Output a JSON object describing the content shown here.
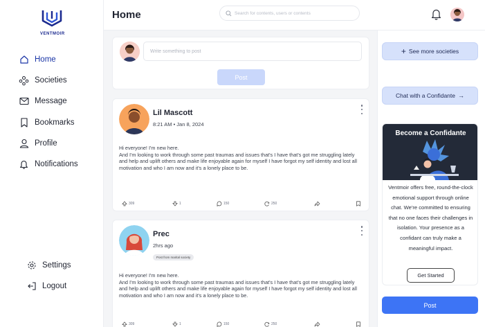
{
  "brand": {
    "logo_text": "VENTMOIR"
  },
  "sidebar": {
    "items": [
      {
        "label": "Home",
        "icon": "home-icon",
        "active": true
      },
      {
        "label": "Societies",
        "icon": "societies-icon"
      },
      {
        "label": "Message",
        "icon": "mail-icon"
      },
      {
        "label": "Bookmarks",
        "icon": "bookmark-icon"
      },
      {
        "label": "Profile",
        "icon": "user-icon"
      },
      {
        "label": "Notifications",
        "icon": "bell-icon"
      }
    ],
    "bottom": [
      {
        "label": "Settings",
        "icon": "gear-icon"
      },
      {
        "label": "Logout",
        "icon": "logout-icon"
      }
    ]
  },
  "header": {
    "title": "Home",
    "search_placeholder": "Search for contents, users or contents"
  },
  "composer": {
    "placeholder": "Write something to post",
    "post_label": "Post"
  },
  "posts": [
    {
      "author": "Lil Mascott",
      "time": "8:21 AM • Jan 8, 2024",
      "tag": "",
      "body": "Hi everyone! I'm new here.\nAnd I'm looking to work through some past traumas and issues that's I have that's got me struggling lately and help and uplift others and make life enjoyable again for myself I have forgot my self identity and lost all motivation and who I am now and it's a lonely place to be.",
      "likes": "309",
      "dislikes": "1",
      "comments": "150",
      "reposts": "250"
    },
    {
      "author": "Prec",
      "time": "2hrs ago",
      "tag": "Post from marital society",
      "body": "Hi everyone! I'm new here.\nAnd I'm looking to work through some past traumas and issues that's I have that's got me struggling lately and help and uplift others and make life enjoyable again for myself I have forgot my self identity and lost all motivation and who I am now and it's a lonely place to be.",
      "likes": "309",
      "dislikes": "1",
      "comments": "150",
      "reposts": "250"
    }
  ],
  "right": {
    "see_more": "See more societies",
    "chat": "Chat with a Confidante",
    "promo_title": "Become a Confidante",
    "promo_text": "Ventmoir offers free, round-the-clock emotional support through online chat. We're committed to ensuring that no one faces their challenges in isolation. Your presence as a confidant can truly make a meaningful impact.",
    "get_started": "Get Started",
    "post_label": "Post"
  },
  "colors": {
    "accent": "#3d74f5",
    "brand": "#1b2a8f",
    "light_button": "#d6e1fb",
    "promo_bg": "#232a38"
  }
}
